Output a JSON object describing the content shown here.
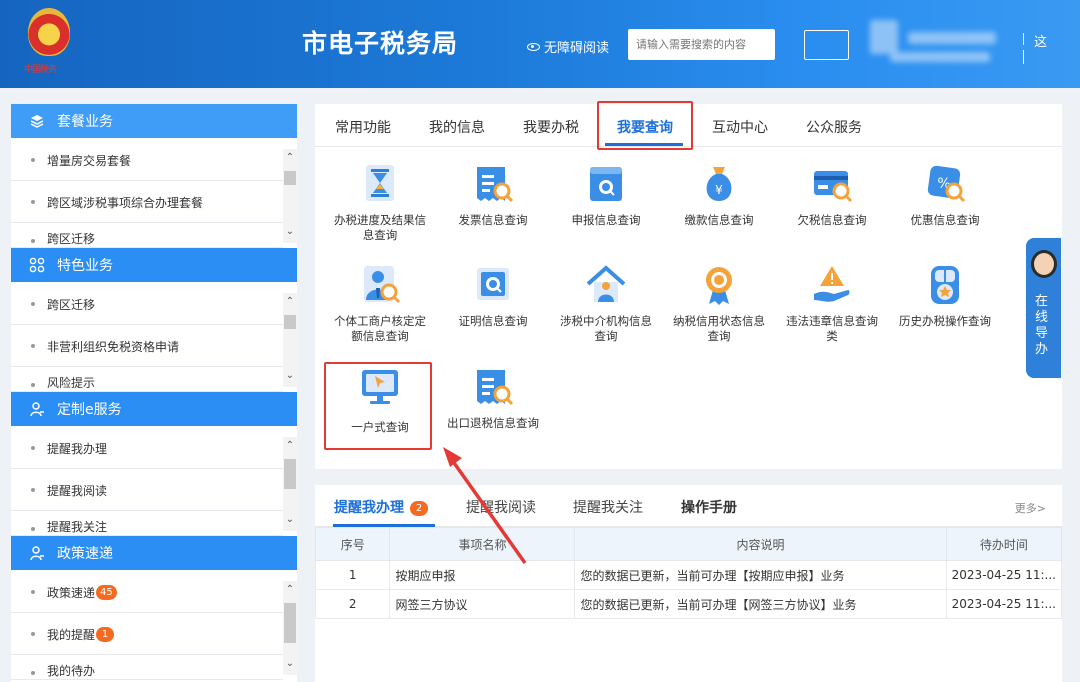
{
  "header": {
    "stamp_text": "中国税务",
    "site_title": "市电子税务局",
    "accessibility_label": "无障碍阅读",
    "search_placeholder": "请输入需要搜索的内容",
    "edge_glyph": "这"
  },
  "sidebar": {
    "sections": [
      {
        "title": "套餐业务",
        "icon": "layers-icon",
        "items": [
          "增量房交易套餐",
          "跨区域涉税事项综合办理套餐",
          "跨区迁移"
        ]
      },
      {
        "title": "特色业务",
        "icon": "apps-icon",
        "items": [
          "跨区迁移",
          "非营利组织免税资格申请",
          "风险提示"
        ]
      },
      {
        "title": "定制e服务",
        "icon": "user-icon",
        "items": [
          "提醒我办理",
          "提醒我阅读",
          "提醒我关注"
        ]
      },
      {
        "title": "政策速递",
        "icon": "user-icon",
        "items": [
          {
            "label": "政策速递",
            "badge": "45"
          },
          {
            "label": "我的提醒",
            "badge": "1"
          },
          {
            "label": "我的待办"
          }
        ]
      }
    ]
  },
  "main": {
    "tabs": [
      "常用功能",
      "我的信息",
      "我要办税",
      "我要查询",
      "互动中心",
      "公众服务"
    ],
    "active_tab": "我要查询",
    "functions": [
      {
        "label": "办税进度及结果信息查询",
        "icon": "hourglass-doc-icon"
      },
      {
        "label": "发票信息查询",
        "icon": "invoice-search-icon"
      },
      {
        "label": "申报信息查询",
        "icon": "declaration-search-icon"
      },
      {
        "label": "缴款信息查询",
        "icon": "money-bag-icon"
      },
      {
        "label": "欠税信息查询",
        "icon": "card-search-icon"
      },
      {
        "label": "优惠信息查询",
        "icon": "discount-tag-icon"
      },
      {
        "label": "个体工商户核定定额信息查询",
        "icon": "person-search-icon"
      },
      {
        "label": "证明信息查询",
        "icon": "certificate-search-icon"
      },
      {
        "label": "涉税中介机构信息查询",
        "icon": "agency-house-icon"
      },
      {
        "label": "纳税信用状态信息查询",
        "icon": "credit-medal-icon"
      },
      {
        "label": "违法违章信息查询类",
        "icon": "warning-hand-icon"
      },
      {
        "label": "历史办税操作查询",
        "icon": "history-star-icon"
      },
      {
        "label": "一户式查询",
        "icon": "monitor-cursor-icon"
      },
      {
        "label": "出口退税信息查询",
        "icon": "invoice-search-icon"
      }
    ]
  },
  "reminders": {
    "tabs": [
      {
        "label": "提醒我办理",
        "badge": "2"
      },
      {
        "label": "提醒我阅读"
      },
      {
        "label": "提醒我关注"
      },
      {
        "label": "操作手册"
      }
    ],
    "more_label": "更多>",
    "columns": [
      "序号",
      "事项名称",
      "内容说明",
      "待办时间"
    ],
    "rows": [
      [
        "1",
        "按期应申报",
        "您的数据已更新，当前可办理【按期应申报】业务",
        "2023-04-25 11:..."
      ],
      [
        "2",
        "网签三方协议",
        "您的数据已更新，当前可办理【网签三方协议】业务",
        "2023-04-25 11:..."
      ]
    ]
  },
  "float_service": {
    "label": "在线导办"
  },
  "colors": {
    "header": "#1d7ad8",
    "accent": "#2b8ef5",
    "highlight": "#e53935",
    "badge": "#f46a1f"
  }
}
